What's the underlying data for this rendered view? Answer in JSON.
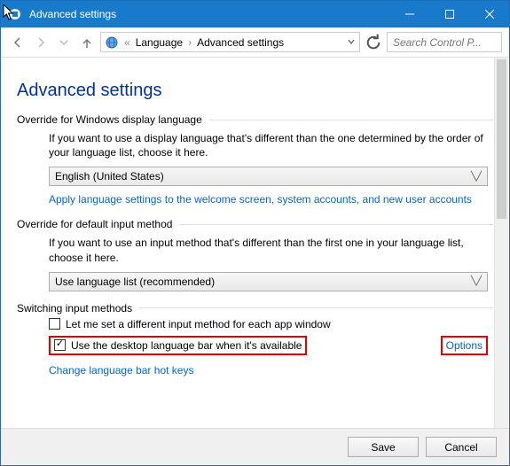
{
  "window": {
    "title": "Advanced settings"
  },
  "address": {
    "seg1": "Language",
    "seg2": "Advanced settings"
  },
  "search": {
    "placeholder": "Search Control P..."
  },
  "page": {
    "title": "Advanced settings"
  },
  "sec1": {
    "heading": "Override for Windows display language",
    "desc": "If you want to use a display language that's different than the one determined by the order of your language list, choose it here.",
    "dropdown": "English (United States)",
    "link": "Apply language settings to the welcome screen, system accounts, and new user accounts"
  },
  "sec2": {
    "heading": "Override for default input method",
    "desc": "If you want to use an input method that's different than the first one in your language list, choose it here.",
    "dropdown": "Use language list (recommended)"
  },
  "sec3": {
    "heading": "Switching input methods",
    "checkbox1": "Let me set a different input method for each app window",
    "checkbox2": "Use the desktop language bar when it's available",
    "options_link": "Options",
    "hotkeys_link": "Change language bar hot keys"
  },
  "footer": {
    "save": "Save",
    "cancel": "Cancel"
  }
}
